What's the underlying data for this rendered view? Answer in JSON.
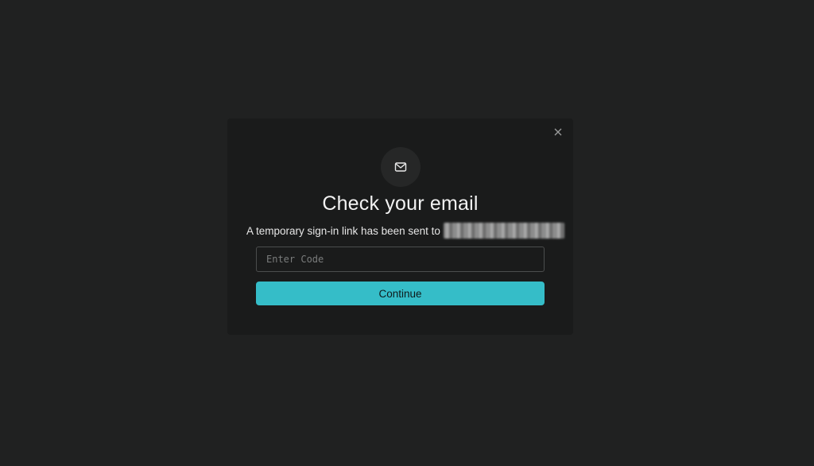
{
  "modal": {
    "title": "Check your email",
    "subtitle": "A temporary sign-in link has been sent to",
    "code_input": {
      "value": "",
      "placeholder": "Enter Code"
    },
    "continue_label": "Continue",
    "icons": {
      "header": "mail-icon",
      "close": "close-icon"
    }
  },
  "colors": {
    "page_background": "#202121",
    "modal_background": "#1a1b1b",
    "accent": "#35bdc8"
  }
}
